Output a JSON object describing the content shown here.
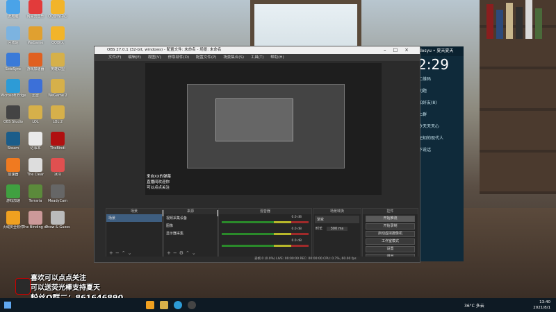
{
  "desktop_icons": [
    {
      "label": "此电脑",
      "color": "#4aa3e8"
    },
    {
      "label": "网易云音乐",
      "color": "#e23b3b"
    },
    {
      "label": "QQ游戏中心",
      "color": "#f2b42a"
    },
    {
      "label": "回收站",
      "color": "#7cb3e0"
    },
    {
      "label": "WeGame",
      "color": "#e0a030"
    },
    {
      "label": "QQ旋风",
      "color": "#f2b42a"
    },
    {
      "label": "SideSync",
      "color": "#3a7ad8"
    },
    {
      "label": "游戏加速器",
      "color": "#e06020"
    },
    {
      "label": "英雄联盟",
      "color": "#d6b04a"
    },
    {
      "label": "Microsoft Edge",
      "color": "#2d9bd6"
    },
    {
      "label": "迅雷",
      "color": "#3c70d8"
    },
    {
      "label": "WeGame 2",
      "color": "#d6b04a"
    },
    {
      "label": "OBS Studio",
      "color": "#444444"
    },
    {
      "label": "LOL",
      "color": "#d6b04a"
    },
    {
      "label": "LOL 2",
      "color": "#d6b04a"
    },
    {
      "label": "Steam",
      "color": "#1b5d8a"
    },
    {
      "label": "记事本",
      "color": "#eaeaea"
    },
    {
      "label": "TheBindi",
      "color": "#b01010"
    },
    {
      "label": "加速器",
      "color": "#f07a20"
    },
    {
      "label": "The Clear",
      "color": "#dddddd"
    },
    {
      "label": "冰冷",
      "color": "#e05050"
    },
    {
      "label": "游戏加速",
      "color": "#40a040"
    },
    {
      "label": "Terraria",
      "color": "#5b8a3b"
    },
    {
      "label": "MeadyCam",
      "color": "#666666"
    },
    {
      "label": "火绒安全软件",
      "color": "#f0a020"
    },
    {
      "label": "The Binding of Isaac: Re...",
      "color": "#cc9999"
    },
    {
      "label": "Draw & Guess",
      "color": "#bbbbbb"
    }
  ],
  "obs": {
    "title": "OBS 27.0.1 (32-bit, windows) - 配置文件: 未命名 - 场景: 未命名",
    "menu": [
      "文件(F)",
      "编辑(E)",
      "视图(V)",
      "停靠部件(D)",
      "配置文件(P)",
      "场景集合(S)",
      "工具(T)",
      "帮助(H)"
    ],
    "chat_lines": [
      "来自XX的弹幕",
      "直播间欢迎你",
      "可以点点关注"
    ],
    "docks": {
      "scenes_header": "场景",
      "scene_items": [
        "场景"
      ],
      "sources_header": "来源",
      "source_items": [
        "视频采集设备",
        "图像",
        "显示器采集"
      ],
      "filter_placeholder": "来源",
      "mixer_header": "混音器",
      "mixer_levels": [
        "0.0 dB",
        "0.0 dB",
        "0.0 dB"
      ],
      "transitions_header": "场景转换",
      "transition_type": "渐变",
      "duration_label": "时长",
      "duration_value": "300 ms",
      "controls_header": "控件",
      "controls": [
        "开始推流",
        "开始录制",
        "启动虚拟摄像机",
        "工作室模式",
        "设置",
        "退出"
      ]
    },
    "statusbar": "丢帧 0 (0.0%)   LIVE: 00:00:00   REC: 00:00:00   CPU: 0.7%, 60.00 fps"
  },
  "side_app": {
    "header": "dosyu • 夏天夏天",
    "clock": "2:29",
    "rows": [
      "二维码",
      "问题",
      "加好友(8)",
      "上群",
      "今天天天心",
      "无知的现代人",
      "不说话"
    ]
  },
  "banner": {
    "line1": "喜欢可以点点关注",
    "line2": "可以送荧光棒支持夏天",
    "line3": "粉丝Q群二：861646890"
  },
  "taskbar": {
    "weather": "36°C 多云",
    "time": "13:40",
    "date": "2021/8/1"
  }
}
